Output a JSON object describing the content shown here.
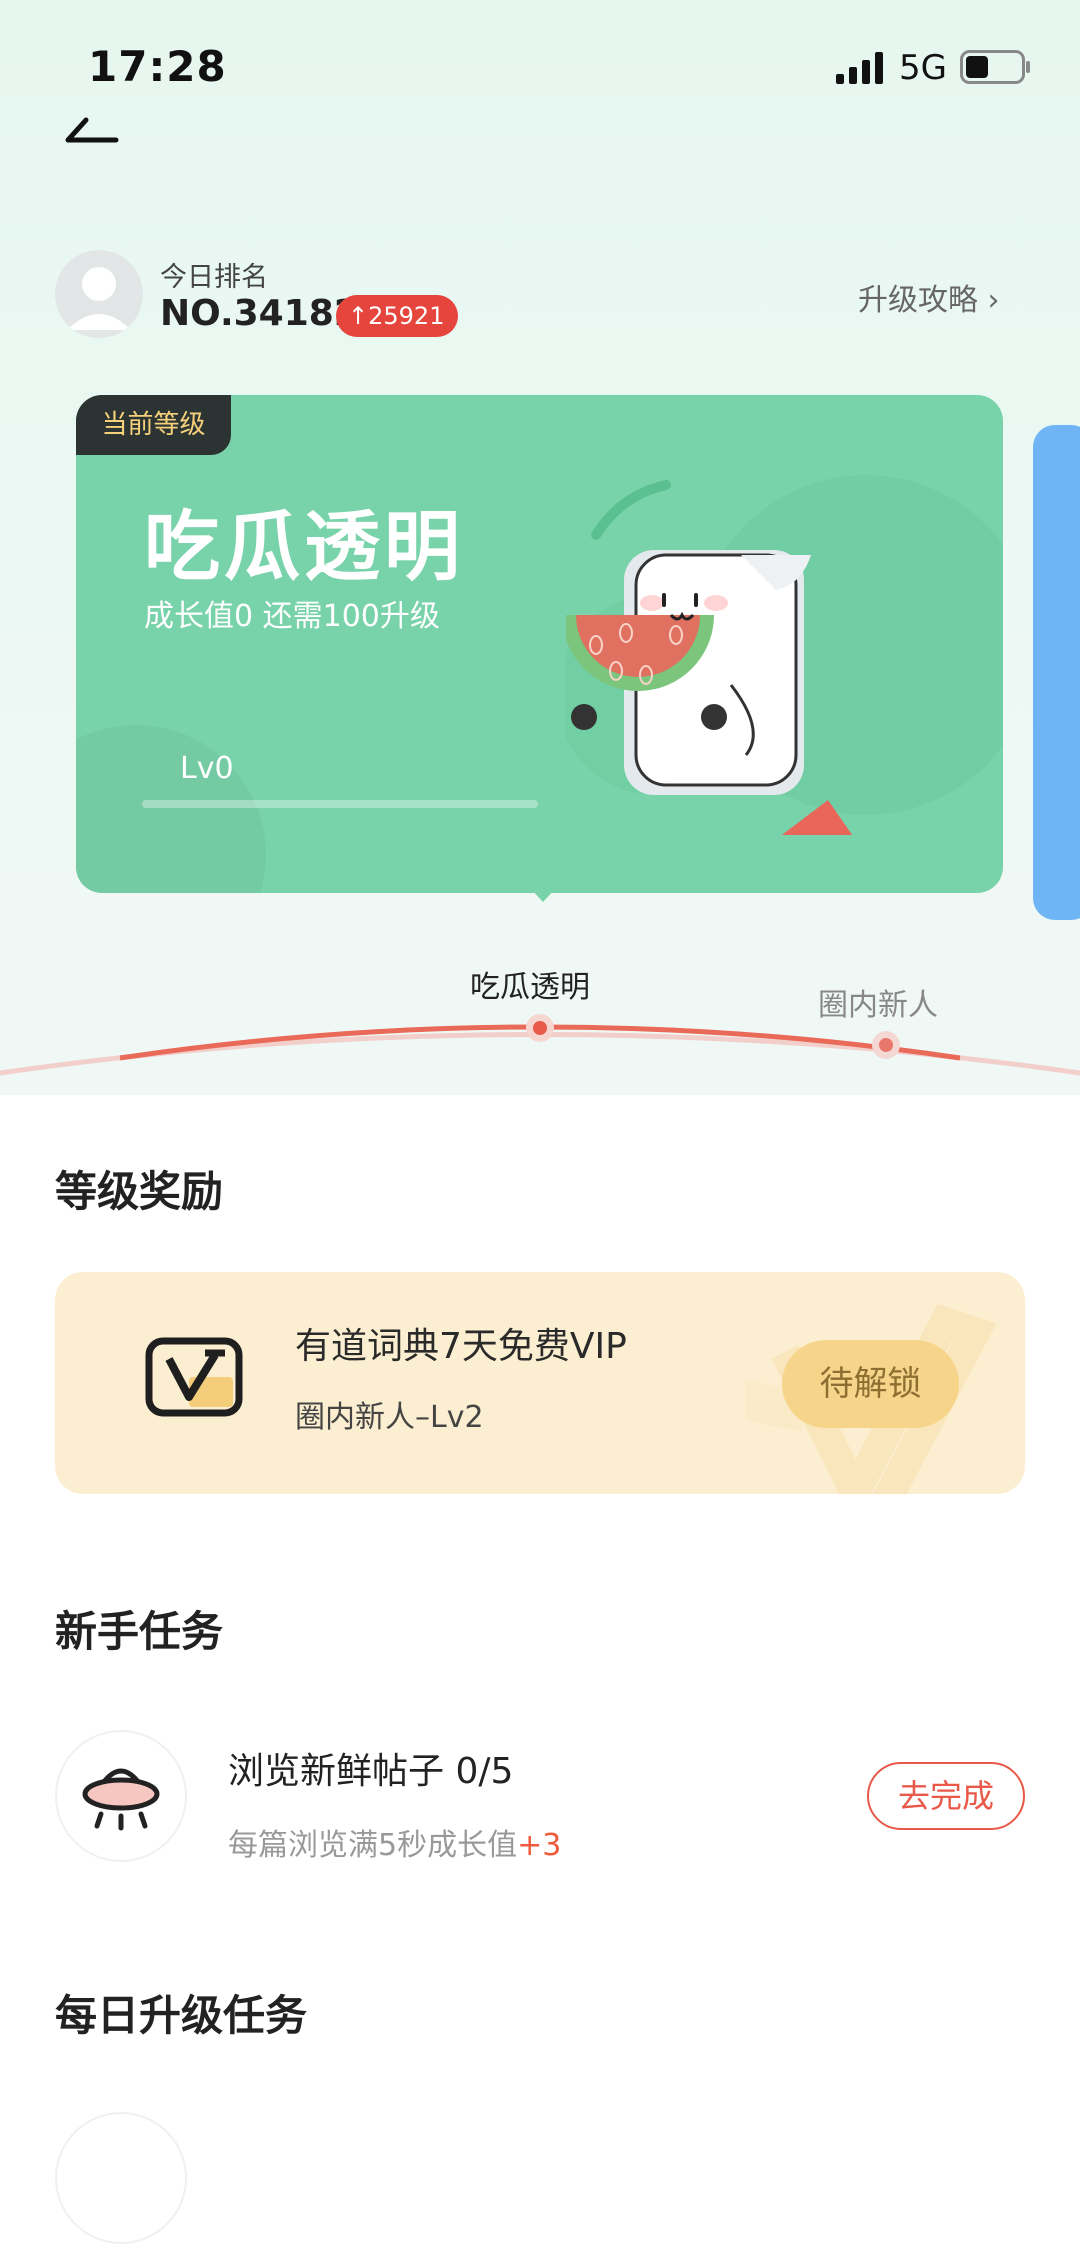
{
  "status_bar": {
    "time": "17:28",
    "network": "5G"
  },
  "rank": {
    "label": "今日排名",
    "value": "NO.34182",
    "change": "↑25921",
    "guide_link": "升级攻略 ›"
  },
  "level_card": {
    "tag": "当前等级",
    "name": "吃瓜透明",
    "progress_text": "成长值0 还需100升级",
    "lv": "Lv0",
    "progress": 0,
    "accent_color": "#79d3aa"
  },
  "level_track": {
    "current": "吃瓜透明",
    "next": "圈内新人"
  },
  "rewards": {
    "title": "等级奖励",
    "item": {
      "title": "有道词典7天免费VIP",
      "subtitle": "圈内新人–Lv2",
      "button": "待解锁"
    }
  },
  "newbie_tasks": {
    "title": "新手任务",
    "task": {
      "title": "浏览新鲜帖子 0/5",
      "desc": "每篇浏览满5秒成长值",
      "reward": "+3",
      "button": "去完成"
    }
  },
  "daily_tasks": {
    "title": "每日升级任务"
  }
}
